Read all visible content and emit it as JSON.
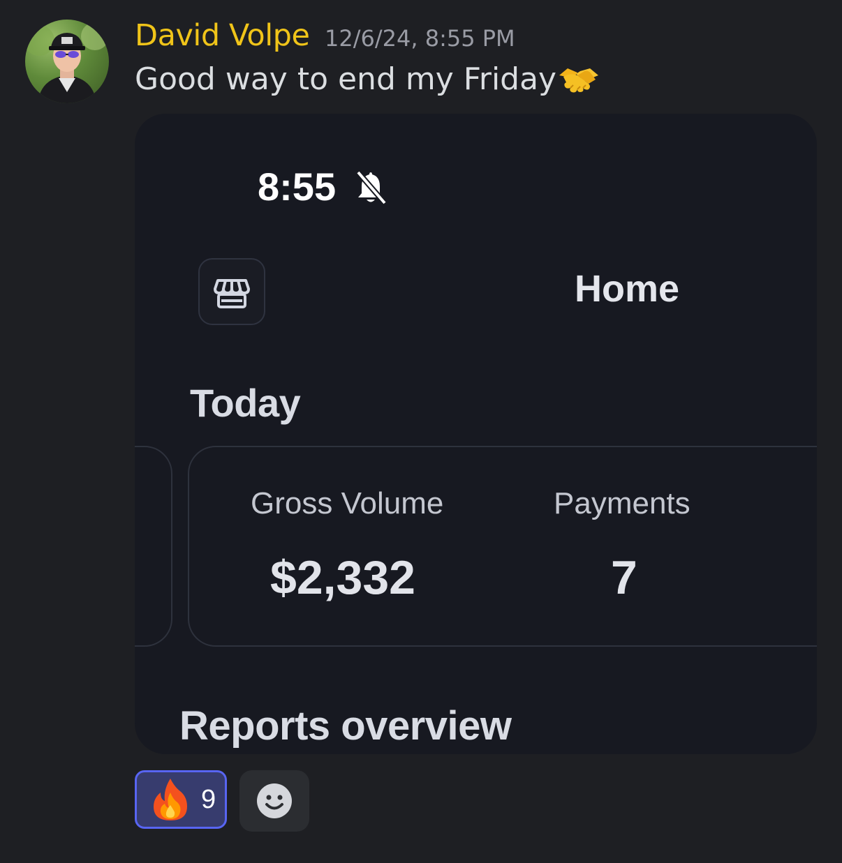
{
  "message": {
    "author": "David Volpe",
    "timestamp": "12/6/24, 8:55 PM",
    "text": "Good way to end my Friday",
    "author_color": "#f0c419"
  },
  "screenshot": {
    "status_time": "8:55",
    "title": "Home",
    "today_heading": "Today",
    "metrics": {
      "gross_label": "Gross Volume",
      "gross_value": "$2,332",
      "payments_label": "Payments",
      "payments_value": "7"
    },
    "reports_heading": "Reports overview"
  },
  "reactions": {
    "fire_count": "9",
    "accent": "#5865f2"
  },
  "icons": [
    "avatar",
    "handshake-emoji-icon",
    "bell-slash-icon",
    "store-icon",
    "fire-emoji-icon",
    "add-reaction-smiley-icon"
  ]
}
